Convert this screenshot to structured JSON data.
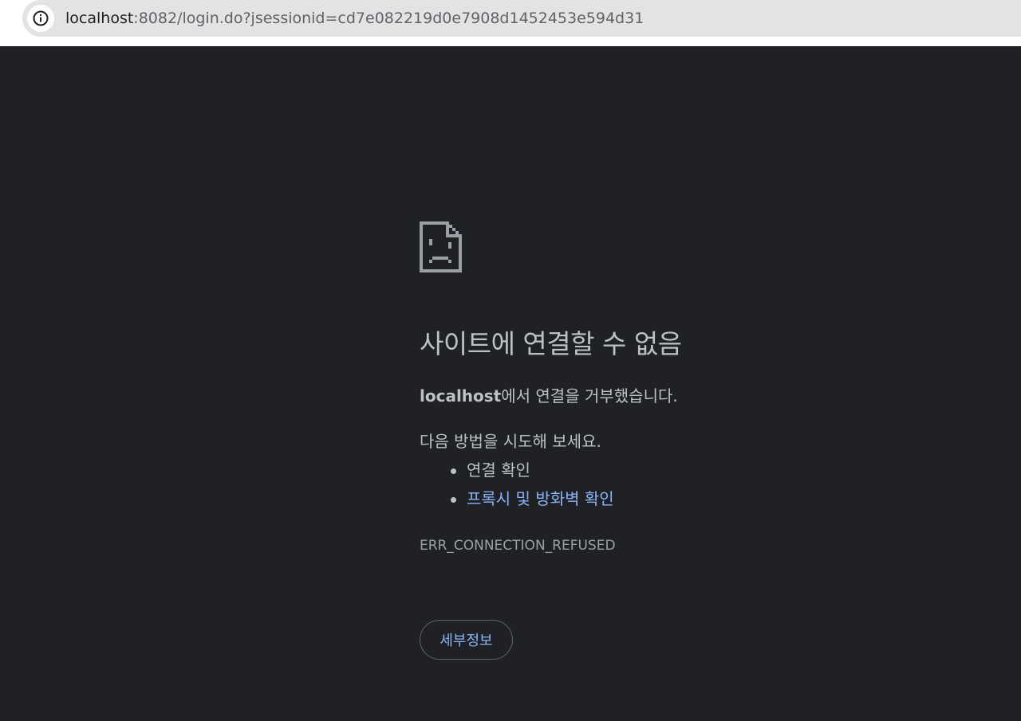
{
  "address_bar": {
    "host": "localhost",
    "rest": ":8082/login.do?jsessionid=cd7e082219d0e7908d1452453e594d31"
  },
  "error_page": {
    "title": "사이트에 연결할 수 없음",
    "host_bold": "localhost",
    "refused_text": "에서 연결을 거부했습니다.",
    "suggestions_heading": "다음 방법을 시도해 보세요.",
    "suggestions": [
      {
        "label": "연결 확인"
      },
      {
        "label": "프록시 및 방화벽 확인"
      }
    ],
    "error_code": "ERR_CONNECTION_REFUSED",
    "details_button": "세부정보"
  },
  "colors": {
    "background": "#202124",
    "text": "#bdc1c6",
    "link": "#8ab4f8",
    "icon": "#9aa0a6"
  },
  "icons": {
    "site_info": "info-icon",
    "error": "sad-document-icon"
  }
}
